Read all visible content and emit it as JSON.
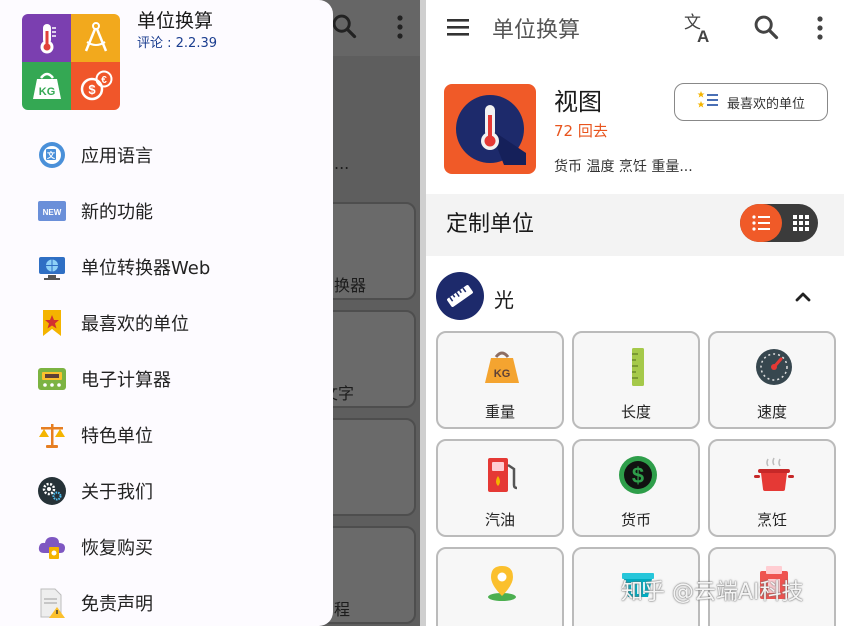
{
  "drawer": {
    "app_title": "单位换算",
    "version": "评论 : 2.2.39",
    "items": [
      {
        "label": "应用语言",
        "icon": "language-icon"
      },
      {
        "label": "新的功能",
        "icon": "new-badge-icon"
      },
      {
        "label": "单位转换器Web",
        "icon": "web-monitor-icon"
      },
      {
        "label": "最喜欢的单位",
        "icon": "bookmark-star-icon"
      },
      {
        "label": "电子计算器",
        "icon": "calculator-icon"
      },
      {
        "label": "特色单位",
        "icon": "scales-icon"
      },
      {
        "label": "关于我们",
        "icon": "gears-icon"
      },
      {
        "label": "恢复购买",
        "icon": "cloud-restore-icon"
      },
      {
        "label": "免责声明",
        "icon": "document-warning-icon"
      }
    ]
  },
  "background": {
    "fragments": [
      "...",
      "换器",
      "文字",
      "]",
      "程"
    ]
  },
  "topbar": {
    "title": "单位换算"
  },
  "hero": {
    "title": "视图",
    "count": "72 回去",
    "description": "货币 温度 烹饪 重量...",
    "favorite_button": "最喜欢的单位"
  },
  "custom": {
    "title": "定制单位"
  },
  "category": {
    "name": "光",
    "icon": "ruler-icon"
  },
  "tiles": [
    {
      "label": "重量",
      "icon": "weight-kg-icon"
    },
    {
      "label": "长度",
      "icon": "ruler-length-icon"
    },
    {
      "label": "速度",
      "icon": "speedometer-icon"
    },
    {
      "label": "汽油",
      "icon": "fuel-pump-icon"
    },
    {
      "label": "货币",
      "icon": "dollar-icon"
    },
    {
      "label": "烹饪",
      "icon": "cooking-pot-icon"
    },
    {
      "label": "",
      "icon": "location-pin-icon"
    },
    {
      "label": "",
      "icon": "basket-icon"
    },
    {
      "label": "",
      "icon": "box-icon"
    }
  ],
  "watermark": "知乎 @云端AI科技",
  "colors": {
    "accent": "#f05a28",
    "navy": "#1d2a6b",
    "version_blue": "#1a3d8f"
  }
}
